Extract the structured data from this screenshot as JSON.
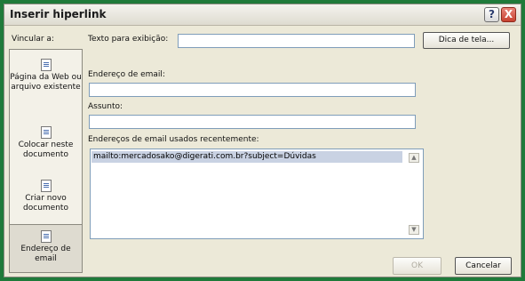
{
  "window": {
    "title": "Inserir hiperlink",
    "help_label": "?",
    "close_label": "X"
  },
  "nav": {
    "heading": "Vincular a:",
    "items": [
      {
        "label": "Página da Web ou arquivo existente",
        "icon": "web-page-icon"
      },
      {
        "label": "Colocar neste documento",
        "icon": "document-place-icon"
      },
      {
        "label": "Criar novo documento",
        "icon": "new-document-icon"
      },
      {
        "label": "Endereço de email",
        "icon": "email-icon"
      }
    ]
  },
  "form": {
    "display_text_label": "Texto para exibição:",
    "display_text_value": "",
    "tooltip_button": "Dica de tela...",
    "email_label": "Endereço de email:",
    "email_value": "",
    "subject_label": "Assunto:",
    "subject_value": "",
    "recent_label": "Endereços de email usados recentemente:",
    "recent_items": [
      "mailto:mercadosako@digerati.com.br?subject=Dúvidas"
    ]
  },
  "buttons": {
    "ok": "OK",
    "cancel": "Cancelar"
  }
}
